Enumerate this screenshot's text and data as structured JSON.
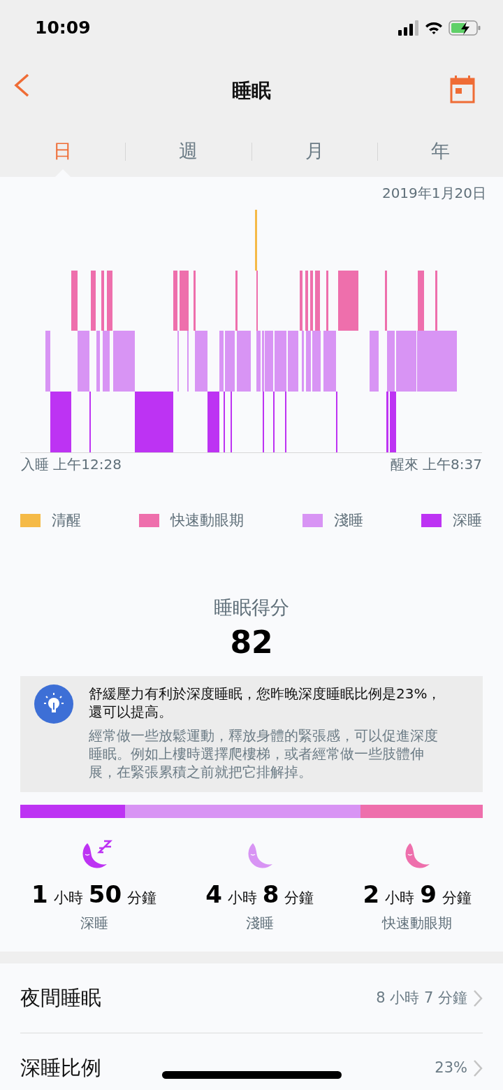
{
  "status_bar": {
    "time": "10:09"
  },
  "header": {
    "title": "睡眠"
  },
  "tabs": [
    {
      "label": "日",
      "selected": true
    },
    {
      "label": "週",
      "selected": false
    },
    {
      "label": "月",
      "selected": false
    },
    {
      "label": "年",
      "selected": false
    }
  ],
  "date": "2019年1月20日",
  "chart_labels": {
    "start": "入睡 上午12:28",
    "end": "醒來 上午8:37"
  },
  "legend": [
    {
      "label": "清醒",
      "color": "#f5ba47"
    },
    {
      "label": "快速動眼期",
      "color": "#ee6fac"
    },
    {
      "label": "淺睡",
      "color": "#d894f4"
    },
    {
      "label": "深睡",
      "color": "#bd33f3"
    }
  ],
  "score": {
    "label": "睡眠得分",
    "value": "82"
  },
  "tip": {
    "headline": "舒緩壓力有利於深度睡眠，您昨晚深度睡眠比例是23%，還可以提高。",
    "body": "經常做一些放鬆運動，釋放身體的緊張感，可以促進深度睡眠。例如上樓時選擇爬樓梯，或者經常做一些肢體伸展，在緊張累積之前就把它排解掉。"
  },
  "stages": [
    {
      "kind": "deep",
      "hours": "1",
      "hours_unit": "小時",
      "minutes": "50",
      "minutes_unit": "分鐘",
      "label": "深睡",
      "color": "#bd33f3"
    },
    {
      "kind": "light",
      "hours": "4",
      "hours_unit": "小時",
      "minutes": "8",
      "minutes_unit": "分鐘",
      "label": "淺睡",
      "color": "#d894f4"
    },
    {
      "kind": "rem",
      "hours": "2",
      "hours_unit": "小時",
      "minutes": "9",
      "minutes_unit": "分鐘",
      "label": "快速動眼期",
      "color": "#ee6fac"
    }
  ],
  "summary_rows": [
    {
      "label": "夜間睡眠",
      "value": "8 小時 7 分鐘"
    },
    {
      "label": "深睡比例",
      "value": "23%"
    }
  ]
}
